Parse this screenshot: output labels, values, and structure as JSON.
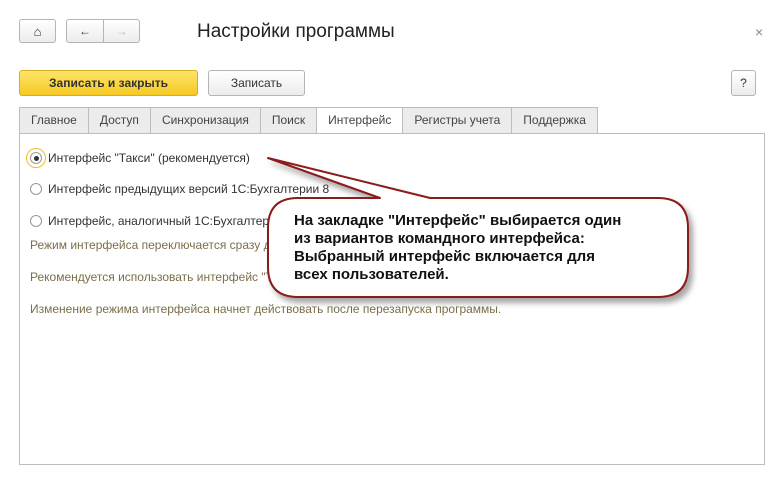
{
  "header": {
    "title": "Настройки программы",
    "close": "×"
  },
  "toolbar": {
    "save_close": "Записать и закрыть",
    "save": "Записать",
    "help": "?"
  },
  "tabs": [
    "Главное",
    "Доступ",
    "Синхронизация",
    "Поиск",
    "Интерфейс",
    "Регистры учета",
    "Поддержка"
  ],
  "options": [
    "Интерфейс \"Такси\" (рекомендуется)",
    "Интерфейс предыдущих версий 1С:Бухгалтерии 8",
    "Интерфейс, аналогичный 1С:Бухгалтерии 7.7"
  ],
  "notes": [
    "Режим интерфейса переключается сразу для всех пользователей",
    "Рекомендуется использовать интерфейс \"Такси\"",
    "Изменение режима интерфейса начнет действовать после перезапуска программы."
  ],
  "callout": {
    "lines": [
      "На закладке \"Интерфейс\" выбирается один",
      "из вариантов командного интерфейса:",
      "Выбранный интерфейс включается для",
      "всех пользователей."
    ]
  }
}
